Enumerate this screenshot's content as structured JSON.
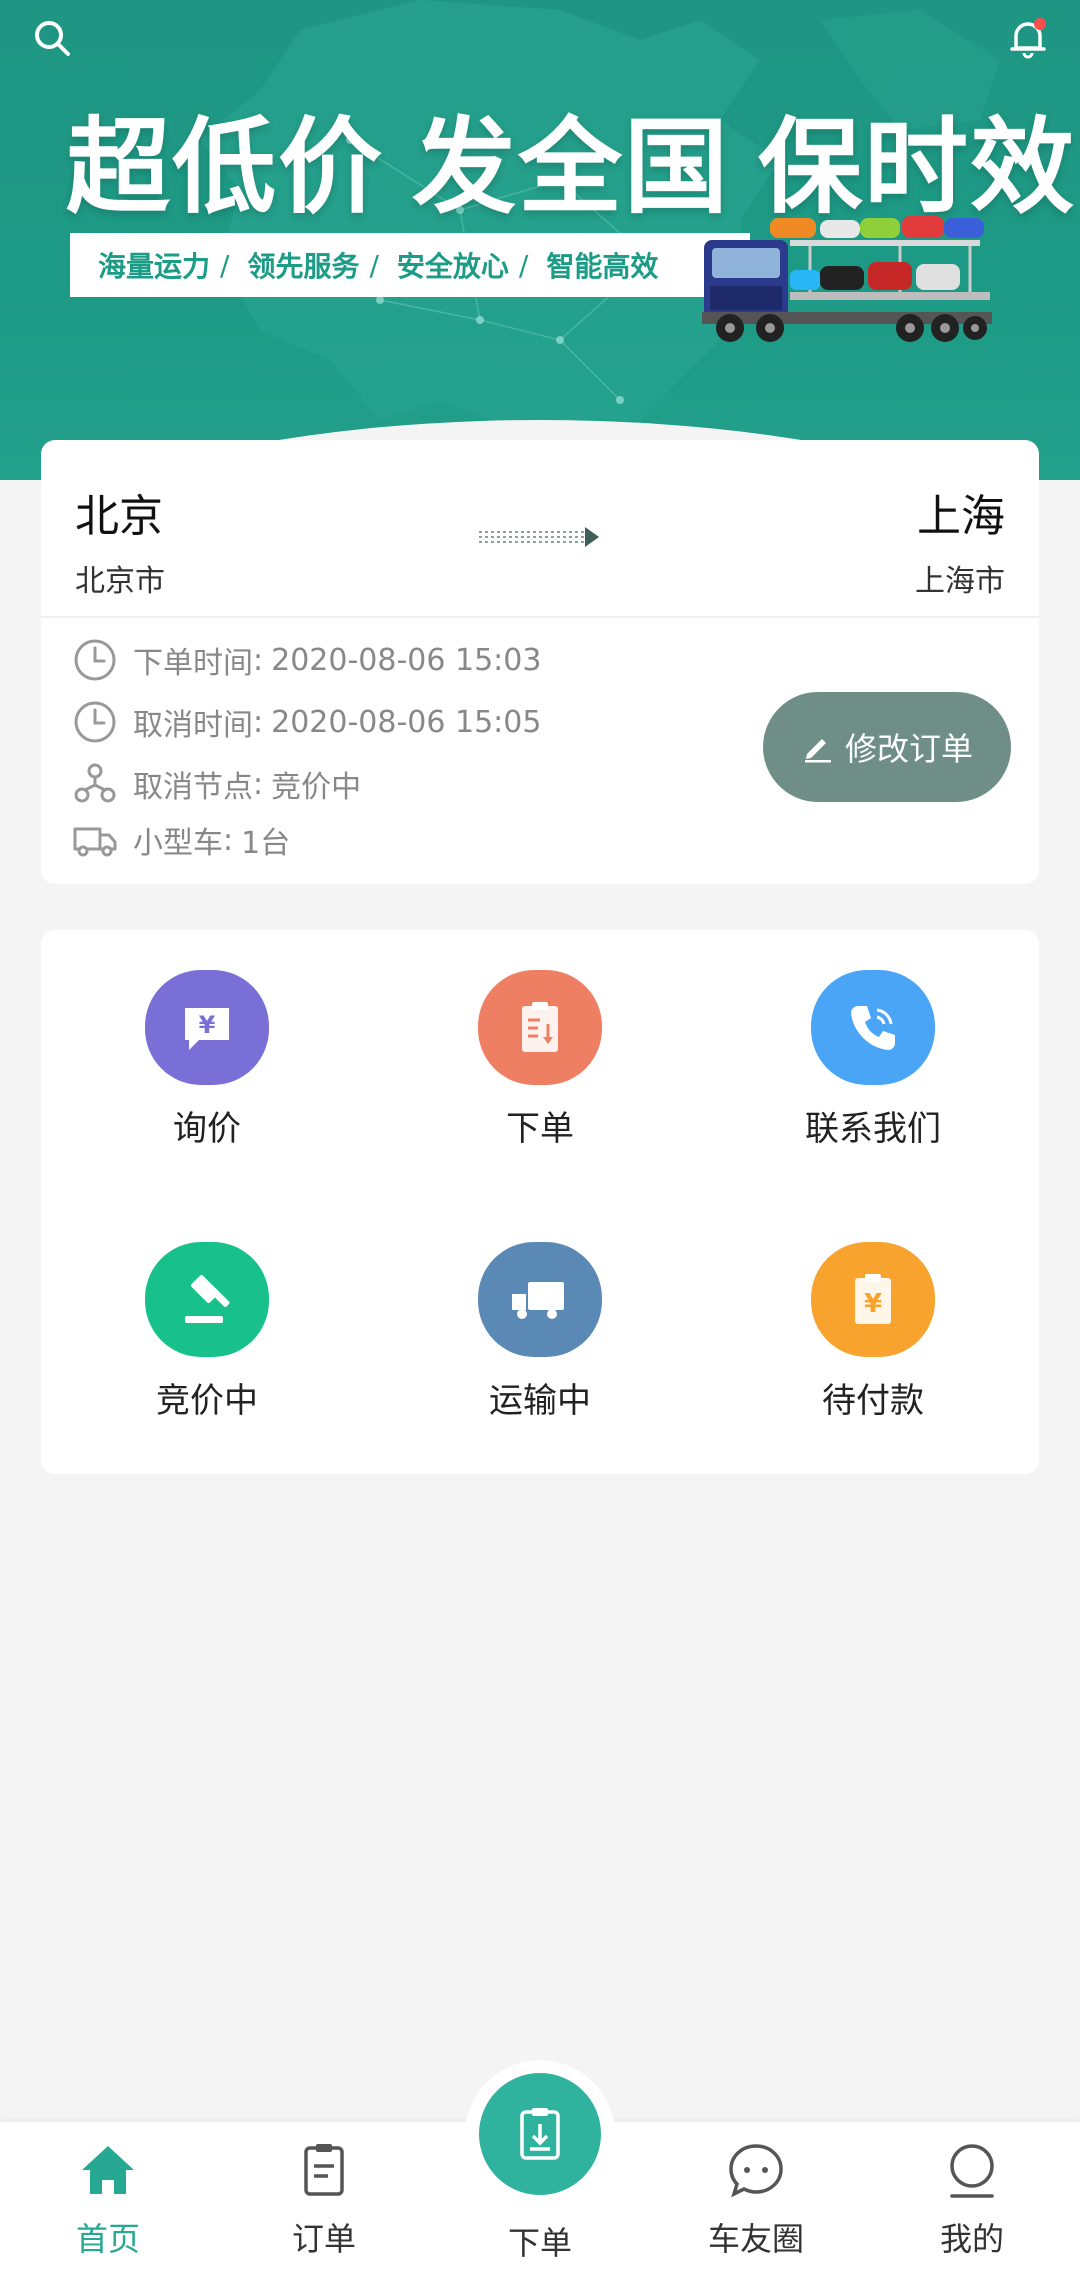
{
  "banner": {
    "slogan": [
      "超低价",
      "发全国",
      "保时效"
    ],
    "tags": [
      "海量运力",
      "领先服务",
      "安全放心",
      "智能高效"
    ],
    "tag_separator": "/"
  },
  "order": {
    "from_city": "北京",
    "from_sub": "北京市",
    "to_city": "上海",
    "to_sub": "上海市",
    "rows": [
      {
        "label": "下单时间",
        "value": "2020-08-06 15:03",
        "icon": "clock-icon"
      },
      {
        "label": "取消时间",
        "value": "2020-08-06 15:05",
        "icon": "clock-icon"
      },
      {
        "label": "取消节点",
        "value": "竞价中",
        "icon": "node-icon"
      },
      {
        "label": "小型车",
        "value": "1台",
        "icon": "truck-icon"
      }
    ],
    "colon": ":",
    "modify_label": "修改订单"
  },
  "grid": [
    {
      "label": "询价",
      "color": "#7a6fd6",
      "icon": "yen-message-icon"
    },
    {
      "label": "下单",
      "color": "#ef7f62",
      "icon": "clipboard-download-icon"
    },
    {
      "label": "联系我们",
      "color": "#4aa5f7",
      "icon": "phone-icon"
    },
    {
      "label": "竞价中",
      "color": "#18c18a",
      "icon": "gavel-icon"
    },
    {
      "label": "运输中",
      "color": "#5a89b5",
      "icon": "truck-icon"
    },
    {
      "label": "待付款",
      "color": "#f7a32e",
      "icon": "yen-clipboard-icon"
    }
  ],
  "nav": {
    "home": "首页",
    "orders": "订单",
    "place_order": "下单",
    "community": "车友圈",
    "mine": "我的"
  },
  "colors": {
    "primary": "#27a892",
    "banner": "#1f9683",
    "modify_button": "#6e8e87"
  }
}
